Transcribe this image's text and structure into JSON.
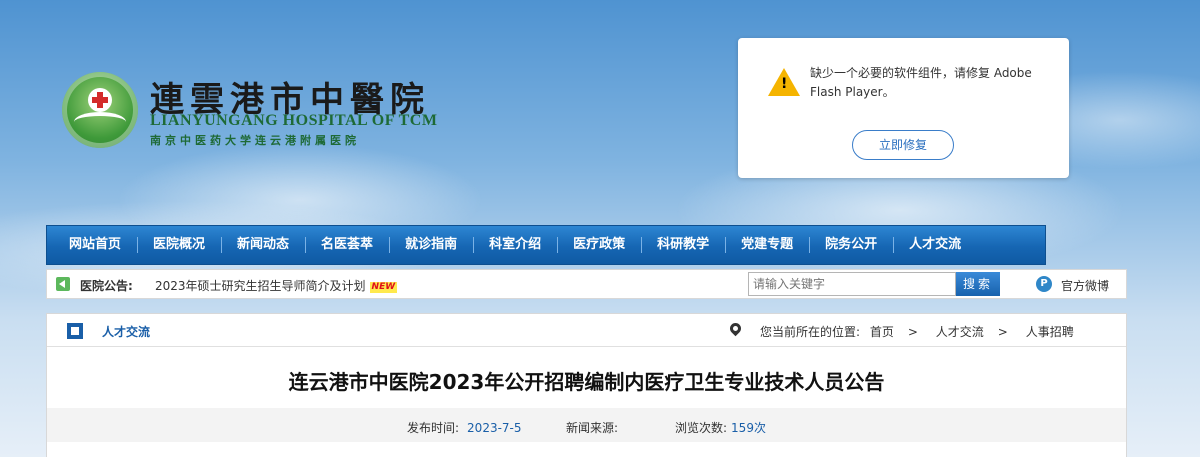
{
  "logo": {
    "title": "連雲港市中醫院",
    "english": "LIANYUNGANG HOSPITAL OF TCM",
    "subtitle": "南京中医药大学连云港附属医院"
  },
  "flash_prompt": {
    "message": "缺少一个必要的软件组件，请修复 Adobe Flash Player。",
    "button": "立即修复"
  },
  "nav": {
    "items": [
      "网站首页",
      "医院概况",
      "新闻动态",
      "名医荟萃",
      "就诊指南",
      "科室介绍",
      "医疗政策",
      "科研教学",
      "党建专题",
      "院务公开",
      "人才交流"
    ]
  },
  "notice": {
    "label": "医院公告:",
    "text": "2023年硕士研究生招生导师简介及计划",
    "badge": "NEW",
    "search_placeholder": "请输入关键字",
    "search_button": "搜索",
    "weibo": "官方微博"
  },
  "content": {
    "section_title": "人才交流",
    "location_label": "您当前所在的位置:",
    "breadcrumb": [
      "首页",
      "人才交流",
      "人事招聘"
    ],
    "article_title": "连云港市中医院2023年公开招聘编制内医疗卫生专业技术人员公告",
    "meta": {
      "date_label": "发布时间:",
      "date": "2023-7-5",
      "source_label": "新闻来源:",
      "source": "",
      "views_label": "浏览次数:",
      "views": "159次"
    }
  }
}
